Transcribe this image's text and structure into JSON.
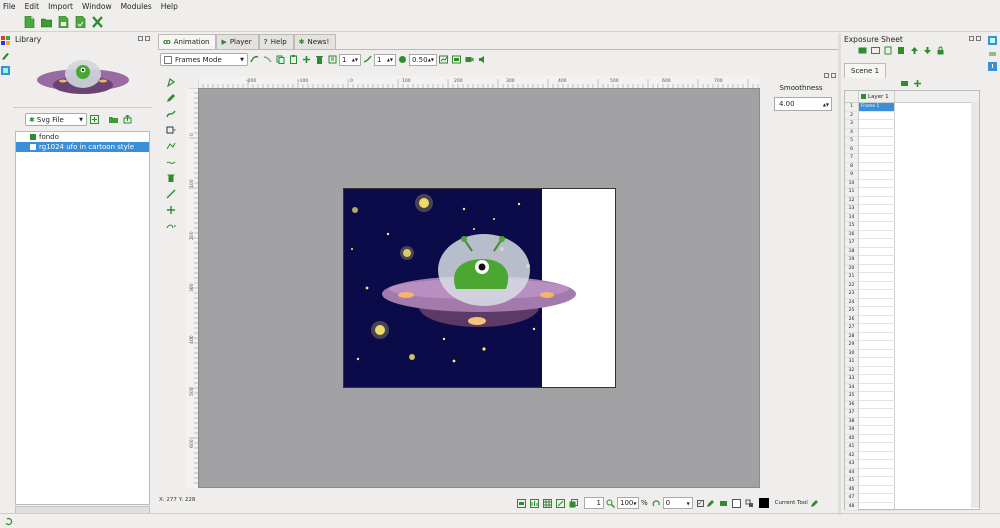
{
  "menu": {
    "items": [
      "File",
      "Edit",
      "Import",
      "Window",
      "Modules",
      "Help"
    ]
  },
  "library": {
    "title": "Library",
    "file_type": "Svg File",
    "items": [
      {
        "label": "fondo",
        "selected": false
      },
      {
        "label": "rg1024 ufo in cartoon style",
        "selected": true
      }
    ]
  },
  "tabs": [
    {
      "label": "Animation",
      "active": true
    },
    {
      "label": "Player",
      "active": false
    },
    {
      "label": "Help",
      "active": false
    },
    {
      "label": "News!",
      "active": false
    }
  ],
  "anim_toolbar": {
    "mode": "Frames Mode",
    "spin1": "1",
    "spin2": "1",
    "opacity": "0.50"
  },
  "ruler": {
    "h_labels": [
      "-200",
      "-100",
      "0",
      "100",
      "200",
      "300",
      "400",
      "500",
      "600",
      "700"
    ],
    "v_labels": [
      "0",
      "100",
      "200",
      "300",
      "400",
      "500",
      "600"
    ]
  },
  "smoothness": {
    "label": "Smoothness",
    "value": "4.00"
  },
  "status": {
    "coords": "X: 277  Y: 228",
    "frame": "1",
    "zoom": "100",
    "zoom_unit": "%",
    "rotation": "0",
    "current_tool_label": "Current Tool"
  },
  "exposure": {
    "title": "Exposure Sheet",
    "scene_tab": "Scene 1",
    "layer": "Layer 1",
    "frame_label": "Frame 1",
    "row_count": 48
  },
  "colors": {
    "accent_green": "#2e8b2e",
    "selection_blue": "#3b8fd6",
    "workspace_gray": "#a2a1a4",
    "space_navy": "#0b0b4a"
  }
}
